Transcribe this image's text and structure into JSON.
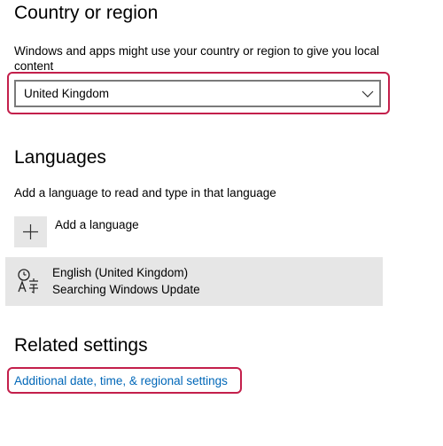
{
  "country": {
    "heading": "Country or region",
    "description": "Windows and apps might use your country or region to give you local content",
    "selected_value": "United Kingdom",
    "dropdown_icon": "chevron-down-icon",
    "highlight_color": "#c31f4b"
  },
  "languages": {
    "heading": "Languages",
    "description": "Add a language to read and type in that language",
    "add_label": "Add a language",
    "add_icon": "plus-icon",
    "items": [
      {
        "name": "English (United Kingdom)",
        "status": "Searching Windows Update",
        "icon": "language-icon"
      }
    ]
  },
  "related": {
    "heading": "Related settings",
    "link_label": "Additional date, time, & regional settings",
    "link_color": "#0067b8"
  }
}
